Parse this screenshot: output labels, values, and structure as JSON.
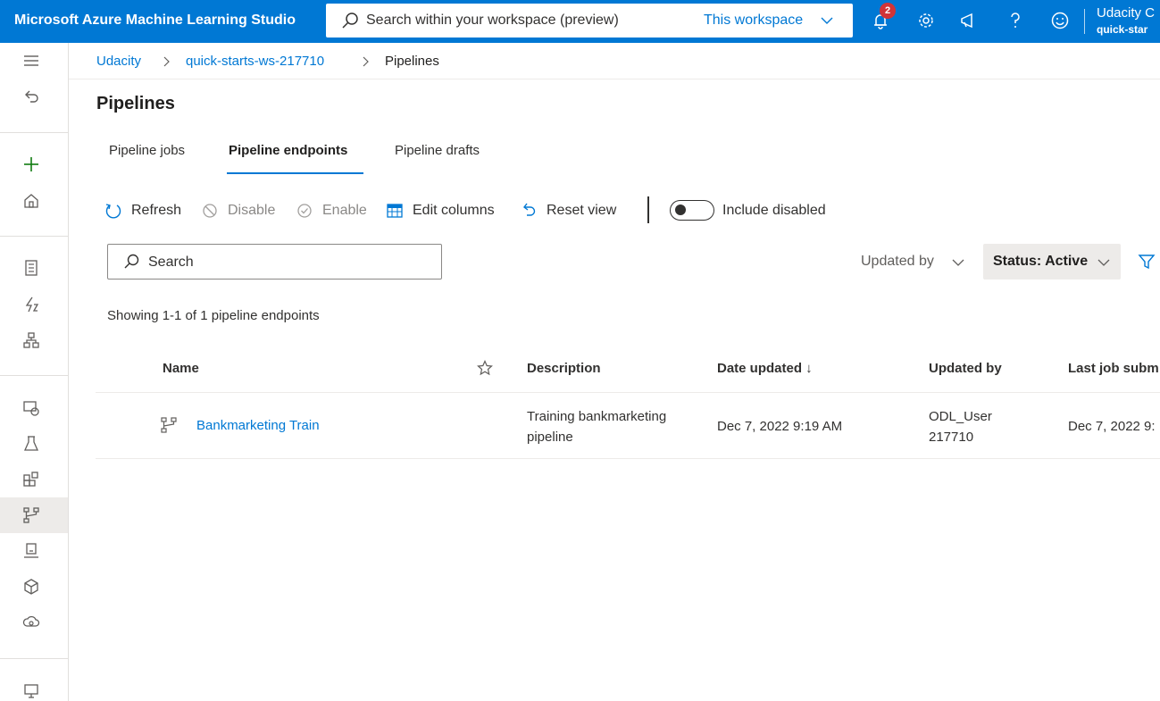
{
  "app": {
    "title": "Microsoft Azure Machine Learning Studio"
  },
  "topbar": {
    "search_placeholder": "Search within your workspace (preview)",
    "search_scope": "This workspace",
    "notification_count": "2",
    "user_name": "Udacity C",
    "user_workspace": "quick-star"
  },
  "breadcrumb": {
    "items": [
      "Udacity",
      "quick-starts-ws-217710",
      "Pipelines"
    ]
  },
  "page": {
    "title": "Pipelines"
  },
  "tabs": [
    {
      "label": "Pipeline jobs"
    },
    {
      "label": "Pipeline endpoints",
      "active": true
    },
    {
      "label": "Pipeline drafts"
    }
  ],
  "toolbar": {
    "refresh": "Refresh",
    "disable": "Disable",
    "enable": "Enable",
    "edit_columns": "Edit columns",
    "reset_view": "Reset view",
    "include_disabled": "Include disabled"
  },
  "filters": {
    "search_placeholder": "Search",
    "updated_by": "Updated by",
    "status": "Status: Active"
  },
  "summary": "Showing 1-1 of 1 pipeline endpoints",
  "table": {
    "columns": {
      "name": "Name",
      "description": "Description",
      "date_updated": "Date updated ↓",
      "updated_by": "Updated by",
      "last_job": "Last job subm"
    },
    "rows": [
      {
        "name": "Bankmarketing Train",
        "description_line1": "Training bankmarketing",
        "description_line2": "pipeline",
        "date_updated": "Dec 7, 2022 9:19 AM",
        "updated_by_line1": "ODL_User",
        "updated_by_line2": "217710",
        "last_job": "Dec 7, 2022 9:"
      }
    ]
  },
  "colors": {
    "brand": "#0078d4",
    "badge": "#d13438"
  }
}
